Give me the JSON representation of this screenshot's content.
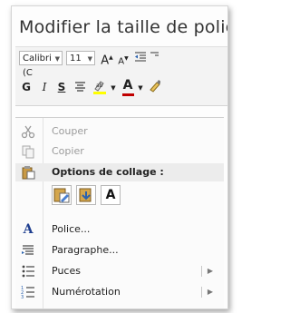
{
  "heading": "Modifier la taille de polic",
  "toolbar": {
    "font_name": "Calibri (C",
    "font_size": "11",
    "grow_font": "A",
    "shrink_font": "A",
    "bold": "G",
    "italic": "I",
    "underline": "S",
    "font_color_letter": "A",
    "highlight_color": "#ffff00",
    "font_color": "#c00000"
  },
  "menu": {
    "items": [
      {
        "label": "Couper",
        "disabled": true
      },
      {
        "label": "Copier",
        "disabled": true
      }
    ],
    "paste_section": "Options de collage :",
    "paste_keep_text": "A",
    "more_items": [
      {
        "label": "Police..."
      },
      {
        "label": "Paragraphe..."
      },
      {
        "label": "Puces"
      },
      {
        "label": "Numérotation"
      }
    ]
  }
}
